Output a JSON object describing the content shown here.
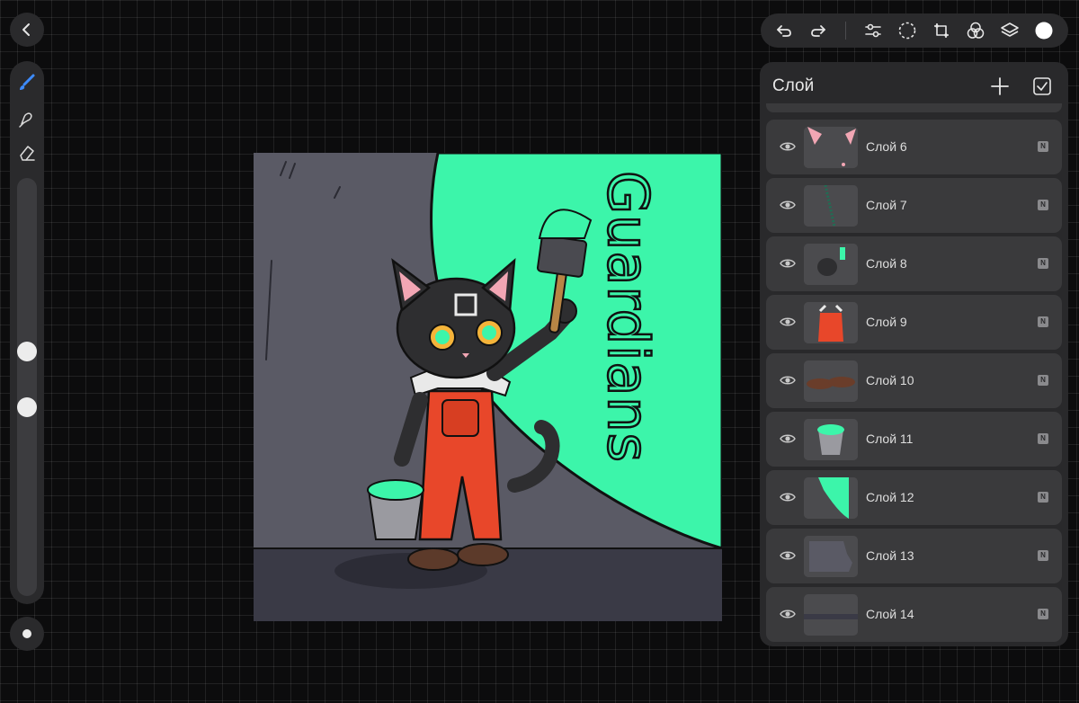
{
  "toolbar": {
    "back_icon": "chevron-left-icon",
    "undo_icon": "undo-icon",
    "redo_icon": "redo-icon",
    "adjust_icon": "adjustments-icon",
    "selection_icon": "selection-icon",
    "transform_icon": "transform-icon",
    "blend_icon": "blend-icon",
    "layers_icon": "layers-icon",
    "color_swatch": "#ffffff"
  },
  "tools": [
    "brush-icon",
    "smudge-icon",
    "eraser-icon"
  ],
  "sliders": {
    "brush_size": 0.41,
    "opacity": 0.55
  },
  "artwork": {
    "text": "Guardians",
    "accent_color": "#3cf5aa",
    "wall_color": "#5a5a65",
    "overalls_color": "#e8472a"
  },
  "layers_panel": {
    "title": "Слой",
    "add_icon": "plus-icon",
    "check_icon": "checkbox-icon",
    "layers": [
      {
        "name": "Слой 6",
        "mode": "N",
        "thumb": "ears"
      },
      {
        "name": "Слой 7",
        "mode": "N",
        "thumb": "stripe"
      },
      {
        "name": "Слой 8",
        "mode": "N",
        "thumb": "cat"
      },
      {
        "name": "Слой 9",
        "mode": "N",
        "thumb": "overalls"
      },
      {
        "name": "Слой 10",
        "mode": "N",
        "thumb": "shoes"
      },
      {
        "name": "Слой 11",
        "mode": "N",
        "thumb": "bucket"
      },
      {
        "name": "Слой 12",
        "mode": "N",
        "thumb": "green"
      },
      {
        "name": "Слой 13",
        "mode": "N",
        "thumb": "wall"
      },
      {
        "name": "Слой 14",
        "mode": "N",
        "thumb": "floor"
      }
    ]
  }
}
